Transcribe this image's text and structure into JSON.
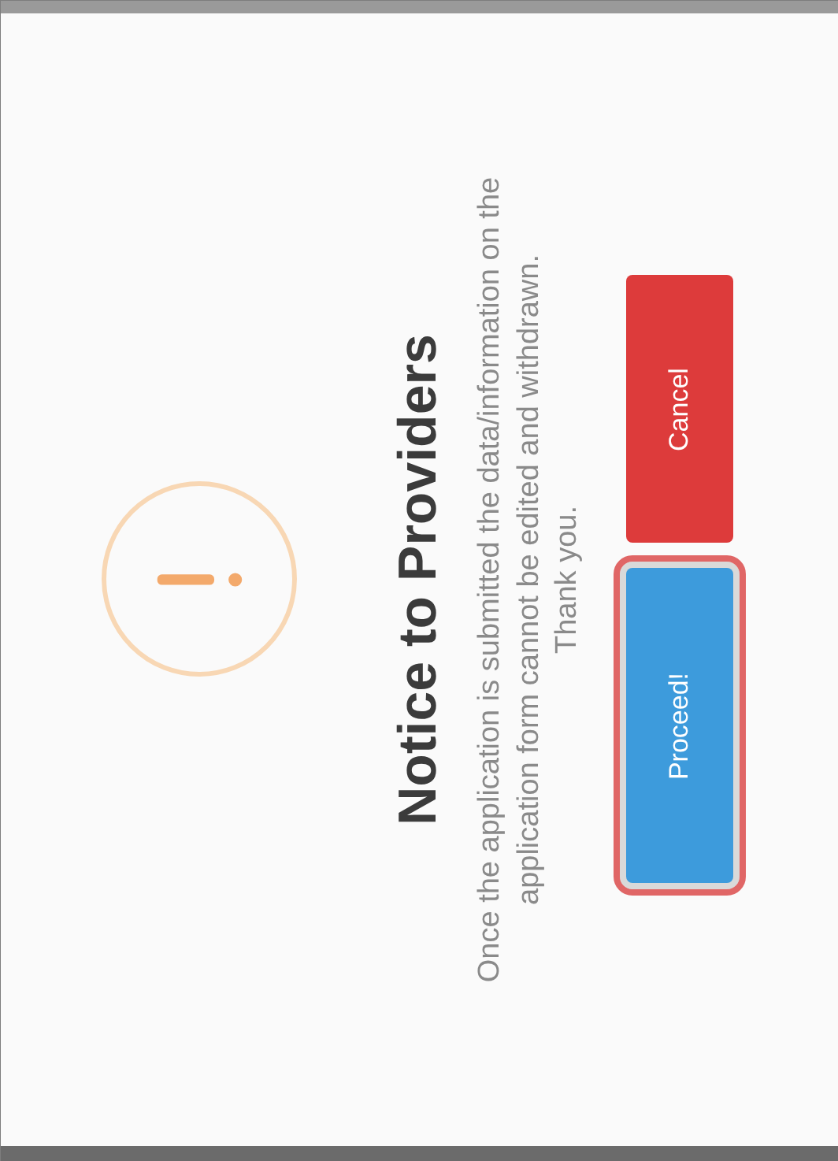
{
  "dialog": {
    "title": "Notice to Providers",
    "message": "Once the application is submitted the data/information on the application form cannot be edited and withdrawn.",
    "closing": "Thank you.",
    "buttons": [
      {
        "label": "Proceed!",
        "kind": "confirm",
        "focused": true
      },
      {
        "label": "Cancel",
        "kind": "cancel",
        "focused": false
      }
    ]
  }
}
